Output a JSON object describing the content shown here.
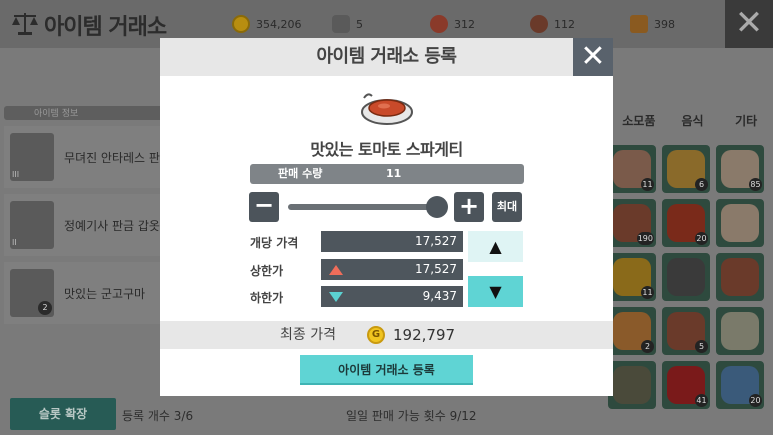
{
  "header": {
    "title": "아이템 거래소",
    "currencies": [
      {
        "icon": "gold-coin-icon",
        "value": "354,206"
      },
      {
        "icon": "stone-icon",
        "value": "5"
      },
      {
        "icon": "meat-icon",
        "value": "312"
      },
      {
        "icon": "helmet-token-icon",
        "value": "112"
      },
      {
        "icon": "medal-icon",
        "value": "398"
      }
    ]
  },
  "left_panel": {
    "heading": "아이템 정보",
    "items": [
      {
        "name": "무뎌진 안타레스 판",
        "badge": "III"
      },
      {
        "name": "정예기사 판금 갑옷",
        "badge": "II"
      },
      {
        "name": "맛있는 군고구마",
        "badge": "2"
      }
    ]
  },
  "footer": {
    "slot_button": "슬롯 확장",
    "register_count": "등록 개수 3/6",
    "daily_limit": "일일 판매 가능 횟수 9/12"
  },
  "categories": [
    "소모품",
    "음식",
    "기타"
  ],
  "grid": {
    "counts": [
      "11",
      "6",
      "85",
      "190",
      "20",
      "",
      "11",
      "",
      "",
      "2",
      "5",
      "",
      "",
      "41",
      "20"
    ]
  },
  "modal": {
    "title": "아이템 거래소 등록",
    "item_name": "맛있는 토마토 스파게티",
    "quantity_label": "판매 수량",
    "quantity_value": "11",
    "quantity_fraction": 0.99,
    "max_label": "최대",
    "unit_price_label": "개당 가격",
    "unit_price": "17,527",
    "upper_label": "상한가",
    "upper_price": "17,527",
    "lower_label": "하한가",
    "lower_price": "9,437",
    "final_label": "최종 가격",
    "final_price": "192,797",
    "register_button": "아이템 거래소 등록"
  },
  "colors": {
    "accent": "#5fd4d4",
    "upper": "#ef6d5a",
    "lower": "#5bd2d2",
    "dark_button": "#4c545b"
  }
}
